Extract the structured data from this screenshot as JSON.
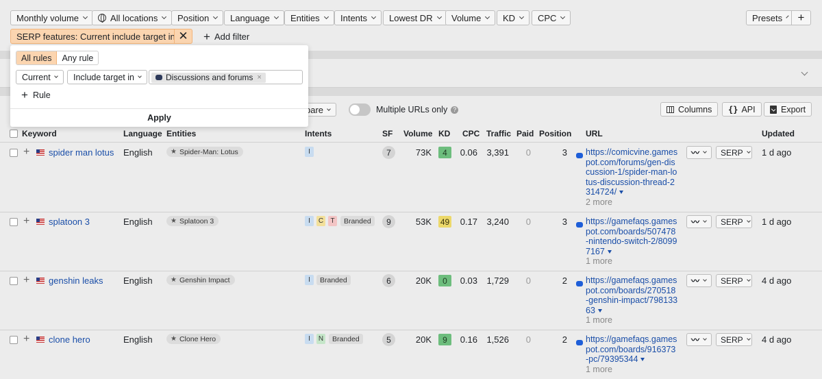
{
  "filters": {
    "monthly_volume": "Monthly volume",
    "all_locations": "All locations",
    "position": "Position",
    "language": "Language",
    "entities": "Entities",
    "intents": "Intents",
    "lowest_dr": "Lowest DR",
    "volume": "Volume",
    "kd": "KD",
    "cpc": "CPC",
    "presets": "Presets",
    "active_chip": "SERP features: Current include target in",
    "add_filter": "Add filter"
  },
  "dropdown": {
    "all_rules": "All rules",
    "any_rule": "Any rule",
    "current": "Current",
    "include_target_in": "Include target in",
    "tag": "Discussions and forums",
    "rule": "Rule",
    "apply": "Apply"
  },
  "toolbar": {
    "compare_fragment": "pare",
    "multiple_urls": "Multiple URLs only",
    "columns": "Columns",
    "api": "API",
    "export": "Export"
  },
  "columns": {
    "keyword": "Keyword",
    "language": "Language",
    "entities": "Entities",
    "intents": "Intents",
    "sf": "SF",
    "volume": "Volume",
    "kd": "KD",
    "cpc": "CPC",
    "traffic": "Traffic",
    "paid": "Paid",
    "position": "Position",
    "url": "URL",
    "updated": "Updated"
  },
  "rows": [
    {
      "keyword": "spider man lotus",
      "language": "English",
      "entity": "Spider-Man: Lotus",
      "intents": [
        "I"
      ],
      "branded": "",
      "sf": "7",
      "volume": "73K",
      "kd": "4",
      "kd_color": "green",
      "cpc": "0.06",
      "traffic": "3,391",
      "paid": "0",
      "position": "3",
      "url": "https://comicvine.gamespot.com/forums/gen-discussion-1/spider-man-lotus-discussion-thread-2314724/",
      "more": "2 more",
      "serp": "SERP",
      "updated": "1 d ago"
    },
    {
      "keyword": "splatoon 3",
      "language": "English",
      "entity": "Splatoon 3",
      "intents": [
        "I",
        "C",
        "T"
      ],
      "branded": "Branded",
      "sf": "9",
      "volume": "53K",
      "kd": "49",
      "kd_color": "yellow",
      "cpc": "0.17",
      "traffic": "3,240",
      "paid": "0",
      "position": "3",
      "url": "https://gamefaqs.gamespot.com/boards/507478-nintendo-switch-2/80997167",
      "more": "1 more",
      "serp": "SERP",
      "updated": "1 d ago"
    },
    {
      "keyword": "genshin leaks",
      "language": "English",
      "entity": "Genshin Impact",
      "intents": [
        "I"
      ],
      "branded": "Branded",
      "sf": "6",
      "volume": "20K",
      "kd": "0",
      "kd_color": "green",
      "cpc": "0.03",
      "traffic": "1,729",
      "paid": "0",
      "position": "2",
      "url": "https://gamefaqs.gamespot.com/boards/270518-genshin-impact/79813363",
      "more": "1 more",
      "serp": "SERP",
      "updated": "4 d ago"
    },
    {
      "keyword": "clone hero",
      "language": "English",
      "entity": "Clone Hero",
      "intents": [
        "I",
        "N"
      ],
      "branded": "Branded",
      "sf": "5",
      "volume": "20K",
      "kd": "9",
      "kd_color": "green",
      "cpc": "0.16",
      "traffic": "1,526",
      "paid": "0",
      "position": "2",
      "url": "https://gamefaqs.gamespot.com/boards/916373-pc/79395344",
      "more": "1 more",
      "serp": "SERP",
      "updated": "4 d ago"
    }
  ]
}
